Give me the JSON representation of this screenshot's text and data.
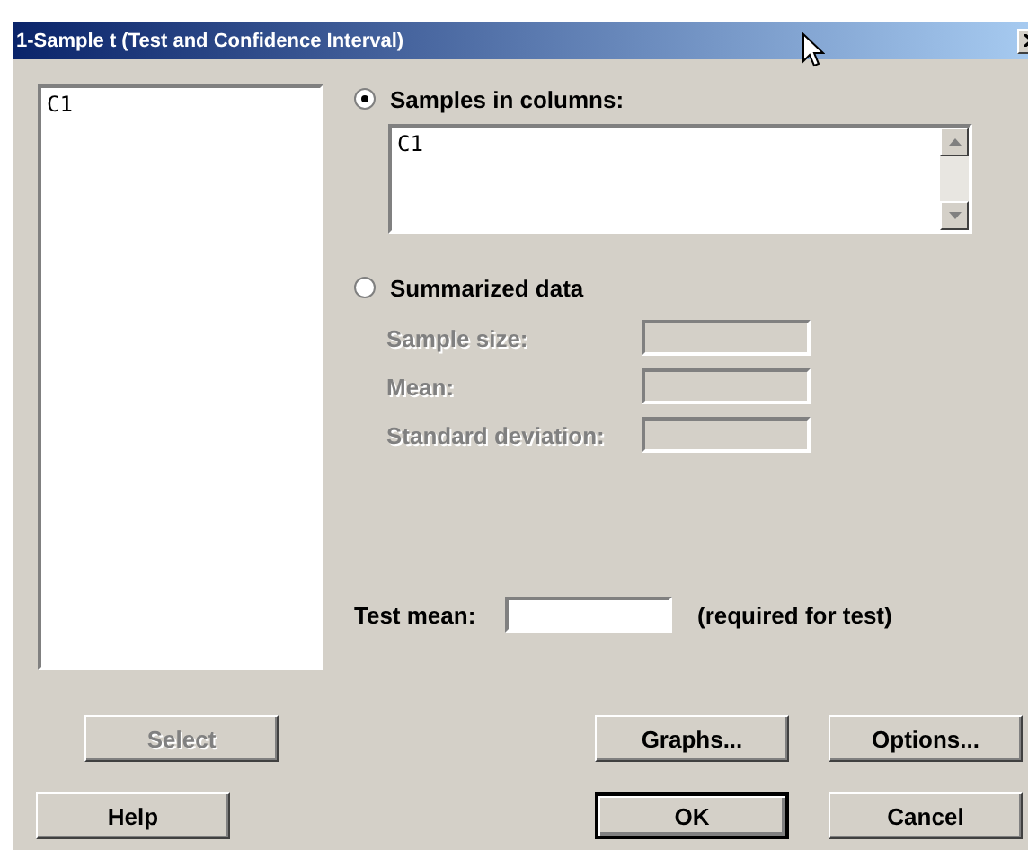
{
  "window": {
    "title": "1-Sample t (Test and Confidence Interval)"
  },
  "variables_list": {
    "items": [
      "C1"
    ]
  },
  "options": [
    {
      "label": "Samples in columns:",
      "selected": true
    },
    {
      "label": "Summarized data",
      "selected": false
    }
  ],
  "columns_field": {
    "value": "C1"
  },
  "summary_fields": [
    {
      "label": "Sample size:",
      "disabled": true
    },
    {
      "label": "Mean:",
      "disabled": true
    },
    {
      "label": "Standard deviation:",
      "disabled": true
    }
  ],
  "test_mean": {
    "label": "Test mean:",
    "note": "(required for test)"
  },
  "buttons": [
    {
      "label": "Select",
      "disabled": true,
      "default": false
    },
    {
      "label": "Graphs...",
      "disabled": false,
      "default": false
    },
    {
      "label": "Options...",
      "disabled": false,
      "default": false
    },
    {
      "label": "Help",
      "disabled": false,
      "default": false
    },
    {
      "label": "OK",
      "disabled": false,
      "default": true
    },
    {
      "label": "Cancel",
      "disabled": false,
      "default": false
    }
  ]
}
